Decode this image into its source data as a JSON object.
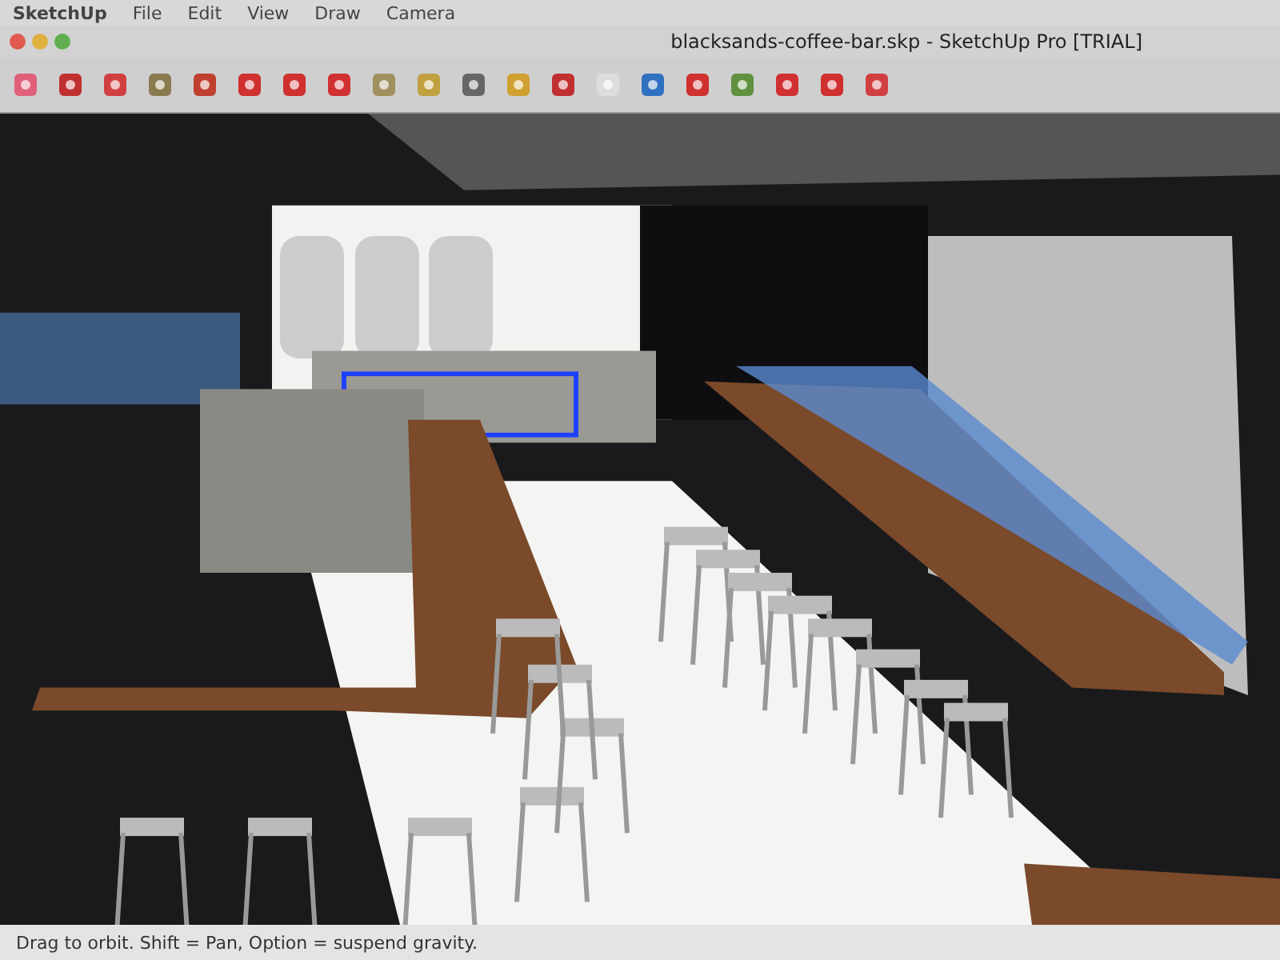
{
  "menu_bar": {
    "items": [
      "SketchUp",
      "File",
      "Edit",
      "View",
      "Draw",
      "Camera"
    ]
  },
  "window": {
    "title": "blacksands-coffee-bar.skp - SketchUp Pro [TRIAL]"
  },
  "status_bar": {
    "text": "Drag to orbit. Shift = Pan, Option = suspend gravity."
  }
}
